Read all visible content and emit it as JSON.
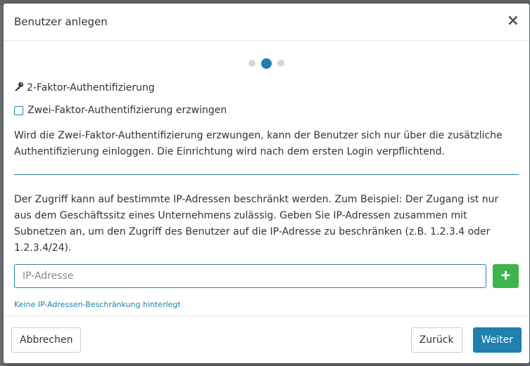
{
  "modal": {
    "title": "Benutzer anlegen",
    "close_label": "×"
  },
  "steps": {
    "total": 3,
    "active": 2
  },
  "twofa": {
    "section_title": "2-Faktor-Authentifizierung",
    "section_icon": "key-icon",
    "checkbox_label": "Zwei-Faktor-Authentifizierung erzwingen",
    "checkbox_checked": false,
    "description": "Wird die Zwei-Faktor-Authentifizierung erzwungen, kann der Benutzer sich nur über die zusätzliche Authentifizierung einloggen. Die Einrichtung wird nach dem ersten Login verpflichtend."
  },
  "ip": {
    "description": "Der Zugriff kann auf bestimmte IP-Adressen beschränkt werden. Zum Beispiel: Der Zugang ist nur aus dem Geschäftssitz eines Unternehmens zulässig. Geben Sie IP-Adressen zusammen mit Subnetzen an, um den Zugriff des Benutzer auf die IP-Adresse zu beschränken (z.B. 1.2.3.4 oder 1.2.3.4/24).",
    "input_placeholder": "IP-Adresse",
    "input_value": "",
    "add_label": "+",
    "hint": "Keine IP-Adressen-Beschränkung hinterlegt"
  },
  "footer": {
    "cancel_label": "Abbrechen",
    "back_label": "Zurück",
    "next_label": "Weiter"
  },
  "colors": {
    "primary": "#1f80ad",
    "success": "#3cb54a"
  }
}
